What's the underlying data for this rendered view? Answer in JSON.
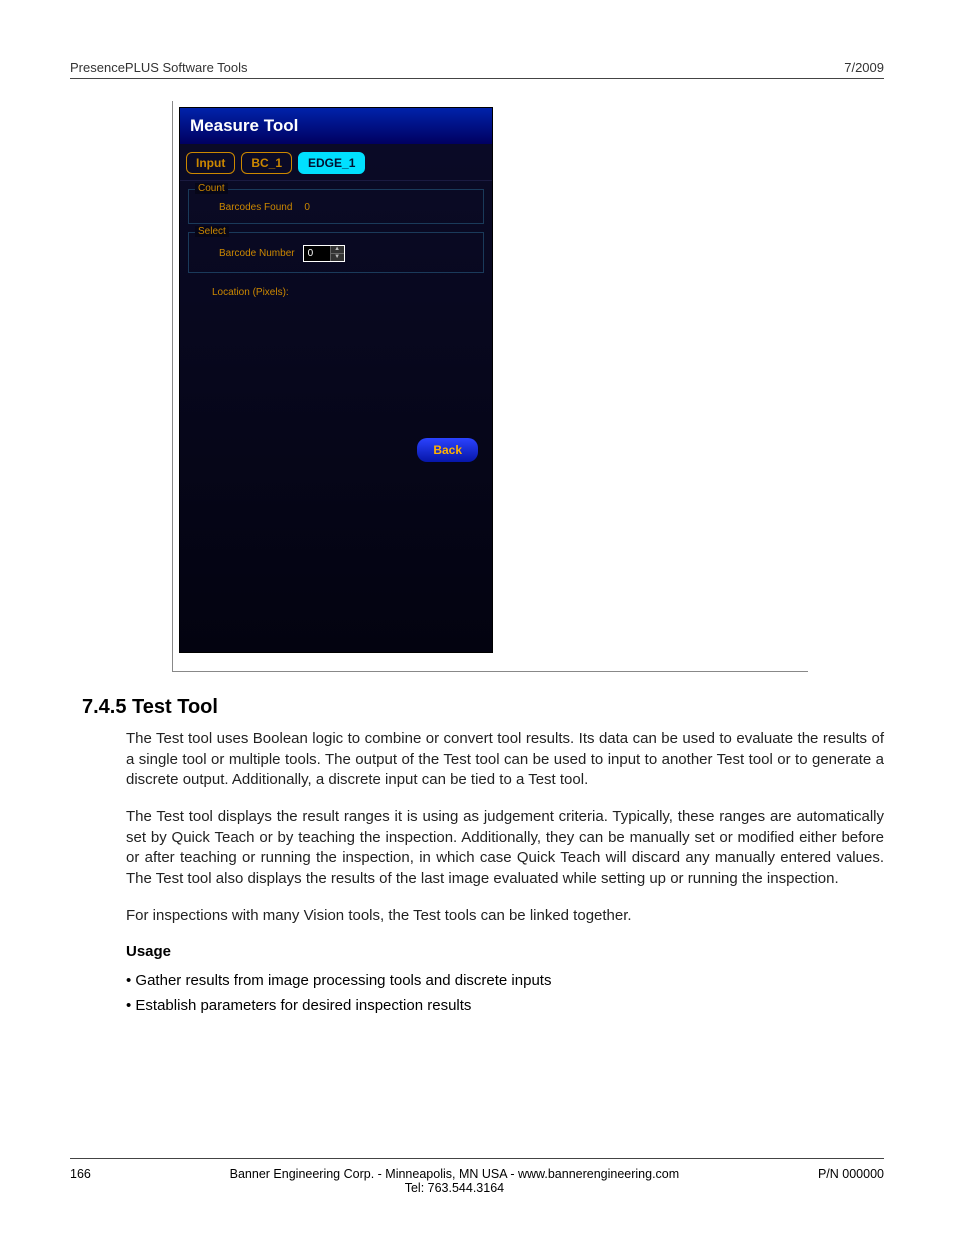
{
  "header": {
    "left": "PresencePLUS Software Tools",
    "right": "7/2009"
  },
  "panel": {
    "title": "Measure Tool",
    "tabs": [
      {
        "label": "Input",
        "selected": false
      },
      {
        "label": "BC_1",
        "selected": false
      },
      {
        "label": "EDGE_1",
        "selected": true
      }
    ],
    "count": {
      "legend": "Count",
      "label": "Barcodes Found",
      "value": "0"
    },
    "select": {
      "legend": "Select",
      "label": "Barcode Number",
      "value": "0"
    },
    "location_label": "Location (Pixels):",
    "back_label": "Back"
  },
  "section": {
    "heading": "7.4.5 Test Tool",
    "p1": "The Test tool  uses Boolean logic to combine or convert tool results. Its data can be used to evaluate the results of a single tool or multiple tools. The output of the Test tool can be used to input to another Test tool or to generate a discrete output. Additionally, a discrete input can be tied to a Test tool.",
    "p2": "The Test tool displays the result ranges it is using as judgement criteria. Typically, these ranges are automatically set by Quick Teach or by teaching the inspection. Additionally, they can be manually set or modified either before or after teaching or running the inspection, in which case Quick Teach will discard any manually entered values. The Test tool also displays the results of the last image evaluated while setting up or running the inspection.",
    "p3": "For inspections with many Vision tools, the Test tools can be linked together.",
    "usage_label": "Usage",
    "bullets": [
      "Gather results from image processing tools and discrete inputs",
      "Establish parameters for desired inspection results"
    ]
  },
  "footer": {
    "page_num": "166",
    "center_line1": "Banner Engineering Corp. - Minneapolis, MN USA - www.bannerengineering.com",
    "center_line2": "Tel: 763.544.3164",
    "right": "P/N 000000"
  }
}
